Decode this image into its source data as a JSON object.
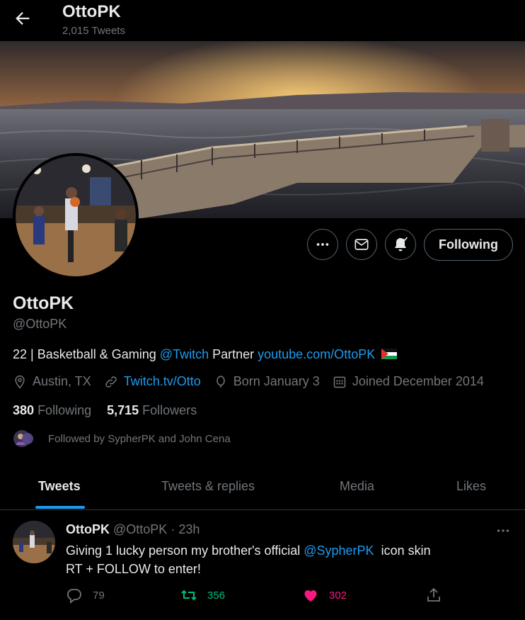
{
  "header": {
    "title": "OttoPK",
    "tweet_count": "2,015 Tweets",
    "back_icon": "arrow-left-icon"
  },
  "actions": {
    "more_icon": "more-horizontal-icon",
    "message_icon": "envelope-icon",
    "notify_icon": "bell-check-icon",
    "follow_label": "Following"
  },
  "profile": {
    "name": "OttoPK",
    "handle": "@OttoPK",
    "bio_prefix": "22 | Basketball & Gaming ",
    "bio_mention": "@Twitch",
    "bio_middle": " Partner ",
    "bio_link": "youtube.com/OttoPK",
    "bio_flag": "palestine-flag-icon",
    "location": "Austin, TX",
    "website": "Twitch.tv/Otto",
    "birthday": "Born January 3",
    "joined": "Joined December 2014",
    "following_count": "380",
    "following_label": "Following",
    "followers_count": "5,715",
    "followers_label": "Followers",
    "followed_by": "Followed by SypherPK and John Cena"
  },
  "tabs": [
    {
      "label": "Tweets",
      "active": true
    },
    {
      "label": "Tweets & replies",
      "active": false
    },
    {
      "label": "Media",
      "active": false
    },
    {
      "label": "Likes",
      "active": false
    }
  ],
  "tweet": {
    "author": "OttoPK",
    "handle": "@OttoPK",
    "separator": " · ",
    "time": "23h",
    "line1_prefix": "Giving 1 lucky person my brother's official ",
    "line1_mention": "@SypherPK",
    "line1_suffix": "  icon skin",
    "line2": "RT + FOLLOW to enter!",
    "reply_count": "79",
    "retweet_count": "356",
    "like_count": "302"
  },
  "colors": {
    "accent": "#1d9bf0",
    "retweet": "#00ba7c",
    "like": "#f91880",
    "muted": "#71767b"
  }
}
